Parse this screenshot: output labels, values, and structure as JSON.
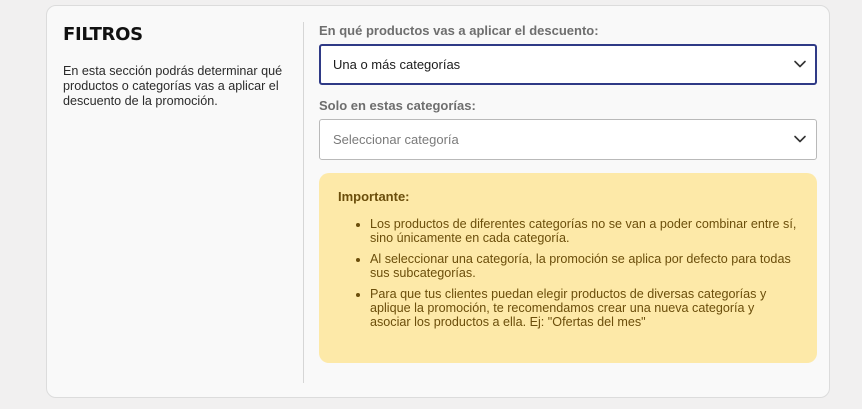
{
  "filters": {
    "title": "FILTROS",
    "description": "En esta sección podrás determinar qué productos o categorías vas a aplicar el descuento de la promoción."
  },
  "apply_to": {
    "label": "En qué productos vas a aplicar el descuento:",
    "selected_value": "Una o más categorías"
  },
  "categories": {
    "label": "Solo en estas categorías:",
    "placeholder": "Seleccionar categoría"
  },
  "notice": {
    "title": "Importante:",
    "items": [
      "Los productos de diferentes categorías no se van a poder combinar entre sí, sino únicamente en cada categoría.",
      "Al seleccionar una categoría, la promoción se aplica por defecto para todas sus subcategorías.",
      "Para que tus clientes puedan elegir productos de diversas categorías y aplique la promoción, te recomendamos crear una nueva categoría y asociar los productos a ella. Ej: \"Ofertas del mes\""
    ]
  },
  "colors": {
    "focus_border": "#2f3a86",
    "notice_background": "#fde9a8",
    "notice_text": "#6b4e0b"
  },
  "icons": {
    "dropdown": "chevron-down-icon"
  }
}
